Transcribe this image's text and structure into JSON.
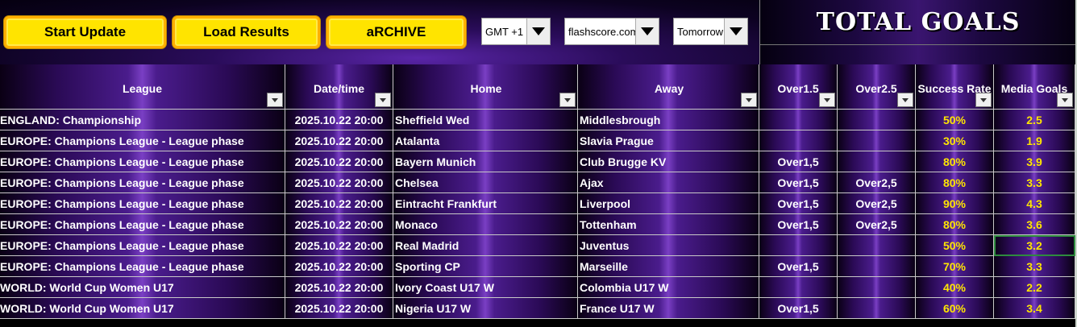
{
  "toolbar": {
    "start_update": "Start Update",
    "load_results": "Load Results",
    "archive": "aRCHIVE",
    "timezone": "GMT +1",
    "source": "flashscore.com",
    "day": "Tomorrow"
  },
  "title": "TOTAL GOALS",
  "columns": [
    "League",
    "Date/time",
    "Home",
    "Away",
    "Over1.5",
    "Over2.5",
    "Success Rate",
    "Media Goals"
  ],
  "rows": [
    {
      "league": "ENGLAND: Championship",
      "date": "2025.10.22 20:00",
      "home": "Sheffield Wed",
      "away": "Middlesbrough",
      "o15": "",
      "o25": "",
      "sr": "50%",
      "mg": "2.5"
    },
    {
      "league": "EUROPE: Champions League - League phase",
      "date": "2025.10.22 20:00",
      "home": "Atalanta",
      "away": "Slavia Prague",
      "o15": "",
      "o25": "",
      "sr": "30%",
      "mg": "1.9"
    },
    {
      "league": "EUROPE: Champions League - League phase",
      "date": "2025.10.22 20:00",
      "home": "Bayern Munich",
      "away": "Club Brugge KV",
      "o15": "Over1,5",
      "o25": "",
      "sr": "80%",
      "mg": "3.9"
    },
    {
      "league": "EUROPE: Champions League - League phase",
      "date": "2025.10.22 20:00",
      "home": "Chelsea",
      "away": "Ajax",
      "o15": "Over1,5",
      "o25": "Over2,5",
      "sr": "80%",
      "mg": "3.3"
    },
    {
      "league": "EUROPE: Champions League - League phase",
      "date": "2025.10.22 20:00",
      "home": "Eintracht Frankfurt",
      "away": "Liverpool",
      "o15": "Over1,5",
      "o25": "Over2,5",
      "sr": "90%",
      "mg": "4.3"
    },
    {
      "league": "EUROPE: Champions League - League phase",
      "date": "2025.10.22 20:00",
      "home": "Monaco",
      "away": "Tottenham",
      "o15": "Over1,5",
      "o25": "Over2,5",
      "sr": "80%",
      "mg": "3.6"
    },
    {
      "league": "EUROPE: Champions League - League phase",
      "date": "2025.10.22 20:00",
      "home": "Real Madrid",
      "away": "Juventus",
      "o15": "",
      "o25": "",
      "sr": "50%",
      "mg": "3.2"
    },
    {
      "league": "EUROPE: Champions League - League phase",
      "date": "2025.10.22 20:00",
      "home": "Sporting CP",
      "away": "Marseille",
      "o15": "Over1,5",
      "o25": "",
      "sr": "70%",
      "mg": "3.3"
    },
    {
      "league": "WORLD: World Cup Women U17",
      "date": "2025.10.22 20:00",
      "home": "Ivory Coast U17 W",
      "away": "Colombia U17 W",
      "o15": "",
      "o25": "",
      "sr": "40%",
      "mg": "2.2"
    },
    {
      "league": "WORLD: World Cup Women U17",
      "date": "2025.10.22 20:00",
      "home": "Nigeria U17 W",
      "away": "France U17 W",
      "o15": "Over1,5",
      "o25": "",
      "sr": "60%",
      "mg": "3.4"
    }
  ]
}
